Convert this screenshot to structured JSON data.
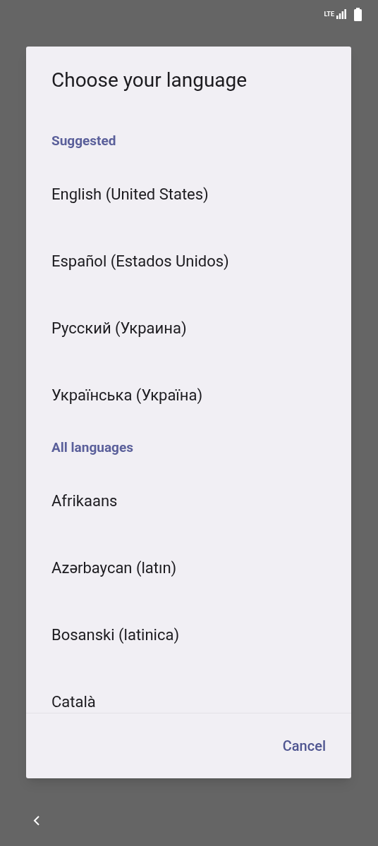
{
  "status_bar": {
    "network": "LTE"
  },
  "dialog": {
    "title": "Choose your language",
    "sections": [
      {
        "header": "Suggested",
        "items": [
          "English (United States)",
          "Español (Estados Unidos)",
          "Русский (Украина)",
          "Українська (Україна)"
        ]
      },
      {
        "header": "All languages",
        "items": [
          "Afrikaans",
          "Azərbaycan (latın)",
          "Bosanski (latinica)",
          "Català"
        ]
      }
    ],
    "cancel": "Cancel"
  }
}
